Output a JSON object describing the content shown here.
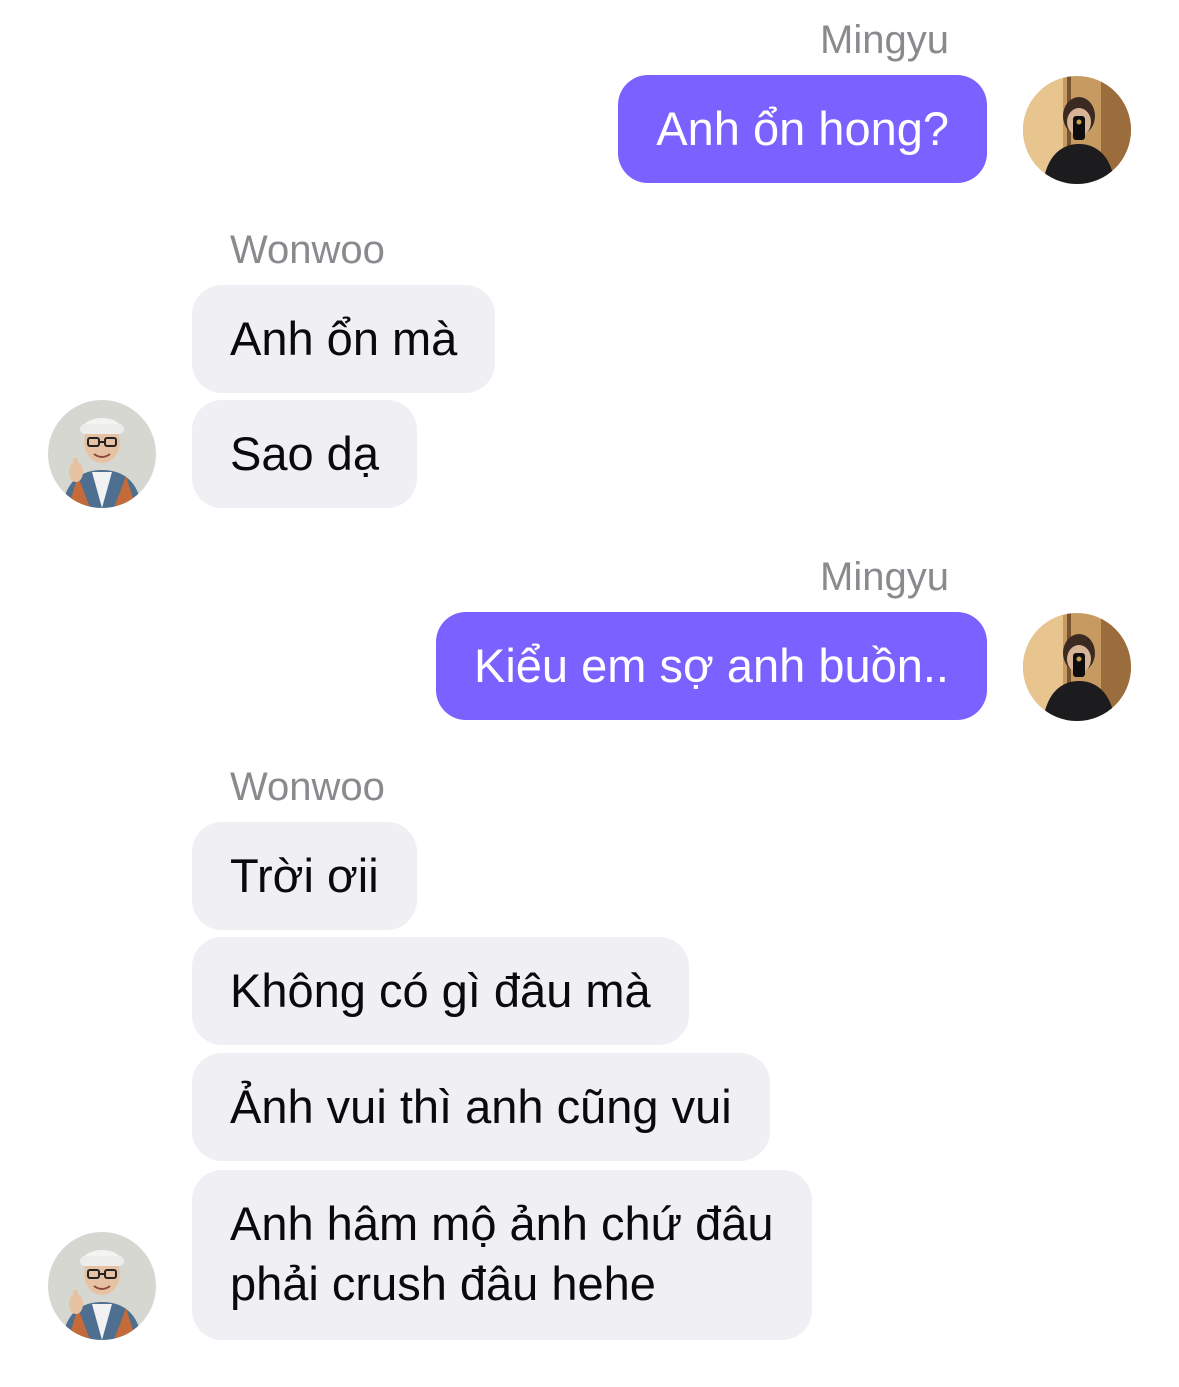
{
  "chat": {
    "groups": [
      {
        "sender": "Mingyu",
        "direction": "outgoing",
        "messages": [
          "Anh ổn hong?"
        ],
        "avatar_icon": "user-photo-mingyu"
      },
      {
        "sender": "Wonwoo",
        "direction": "incoming",
        "messages": [
          "Anh ổn mà",
          "Sao dạ"
        ],
        "avatar_icon": "user-photo-wonwoo"
      },
      {
        "sender": "Mingyu",
        "direction": "outgoing",
        "messages": [
          "Kiểu em sợ anh buồn.."
        ],
        "avatar_icon": "user-photo-mingyu"
      },
      {
        "sender": "Wonwoo",
        "direction": "incoming",
        "messages": [
          "Trời ơii",
          "Không có gì đâu mà",
          "Ảnh vui thì anh cũng vui",
          "Anh hâm mộ ảnh chứ đâu\nphải crush đâu hehe"
        ],
        "avatar_icon": "user-photo-wonwoo"
      }
    ]
  },
  "colors": {
    "outgoing_bubble": "#7b61ff",
    "incoming_bubble": "#efeff4",
    "sender_name": "#8a8a8e"
  }
}
